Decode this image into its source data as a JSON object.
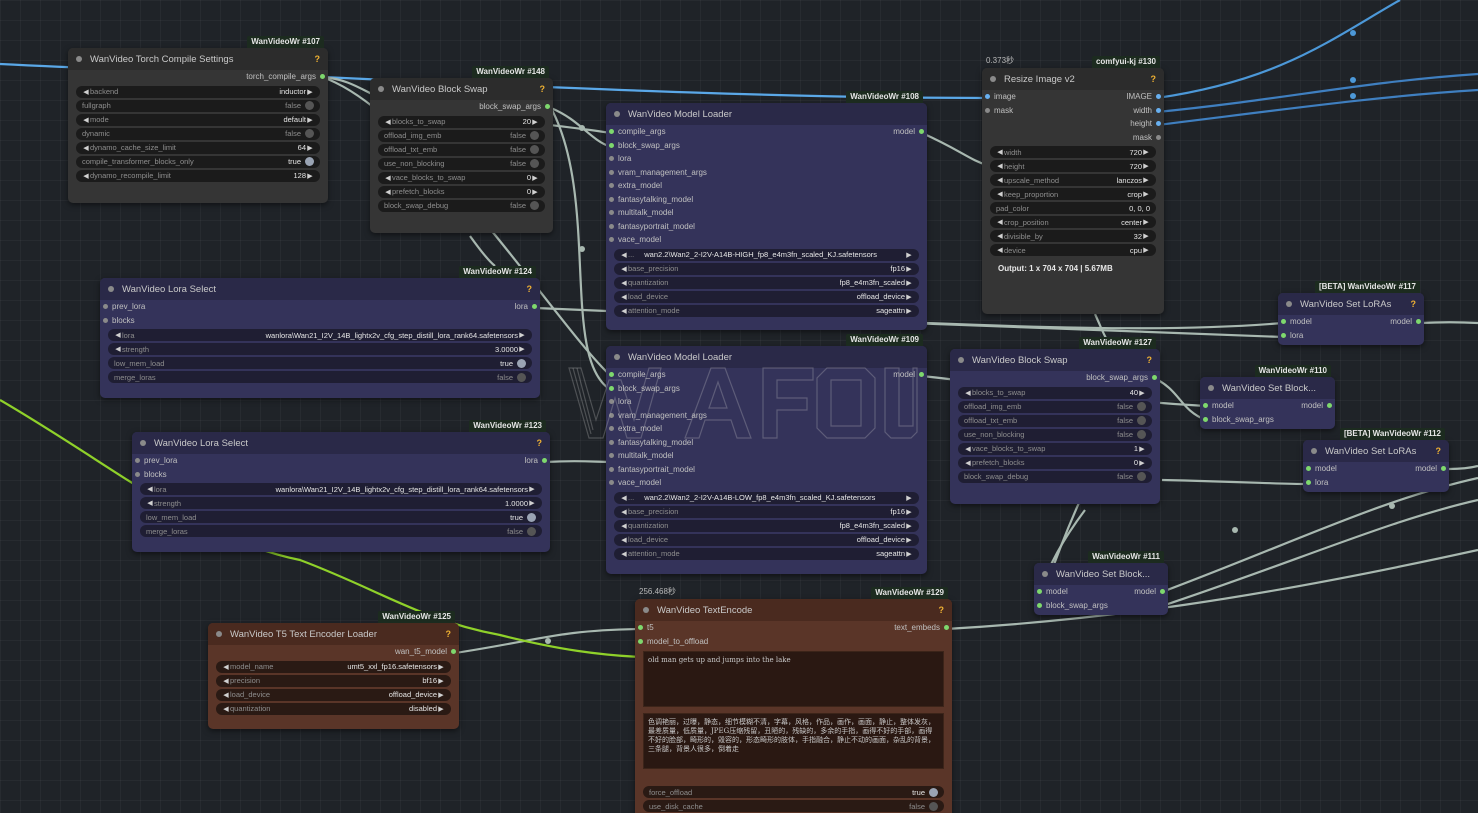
{
  "nodes": {
    "n107": {
      "badge": "WanVideoWr #107",
      "title": "WanVideo Torch Compile Settings",
      "help": "?",
      "output": "torch_compile_args",
      "widgets": {
        "backend": {
          "label": "backend",
          "value": "inductor"
        },
        "fullgraph": {
          "label": "fullgraph",
          "value": "false"
        },
        "mode": {
          "label": "mode",
          "value": "default"
        },
        "dynamic": {
          "label": "dynamic",
          "value": "false"
        },
        "dynamo_cache_size_limit": {
          "label": "dynamo_cache_size_limit",
          "value": "64"
        },
        "compile_transformer_blocks_only": {
          "label": "compile_transformer_blocks_only",
          "value": "true"
        },
        "dynamo_recompile_limit": {
          "label": "dynamo_recompile_limit",
          "value": "128"
        }
      }
    },
    "n148": {
      "badge": "WanVideoWr #148",
      "title": "WanVideo Block Swap",
      "help": "?",
      "output": "block_swap_args",
      "widgets": {
        "blocks_to_swap": {
          "label": "blocks_to_swap",
          "value": "20"
        },
        "offload_img_emb": {
          "label": "offload_img_emb",
          "value": "false"
        },
        "offload_txt_emb": {
          "label": "offload_txt_emb",
          "value": "false"
        },
        "use_non_blocking": {
          "label": "use_non_blocking",
          "value": "false"
        },
        "vace_blocks_to_swap": {
          "label": "vace_blocks_to_swap",
          "value": "0"
        },
        "prefetch_blocks": {
          "label": "prefetch_blocks",
          "value": "0"
        },
        "block_swap_debug": {
          "label": "block_swap_debug",
          "value": "false"
        }
      }
    },
    "n108": {
      "badge": "WanVideoWr #108",
      "title": "WanVideo Model Loader",
      "output": "model",
      "inputs": [
        "compile_args",
        "block_swap_args",
        "lora",
        "vram_management_args",
        "extra_model",
        "fantasytalking_model",
        "multitalk_model",
        "fantasyportrait_model",
        "vace_model"
      ],
      "widgets": {
        "model": {
          "label": "...",
          "value": "wan2.2\\Wan2_2-I2V-A14B-HIGH_fp8_e4m3fn_scaled_KJ.safetensors"
        },
        "base_precision": {
          "label": "base_precision",
          "value": "fp16"
        },
        "quantization": {
          "label": "quantization",
          "value": "fp8_e4m3fn_scaled"
        },
        "load_device": {
          "label": "load_device",
          "value": "offload_device"
        },
        "attention_mode": {
          "label": "attention_mode",
          "value": "sageattn"
        }
      }
    },
    "n109": {
      "badge": "WanVideoWr #109",
      "title": "WanVideo Model Loader",
      "output": "model",
      "inputs": [
        "compile_args",
        "block_swap_args",
        "lora",
        "vram_management_args",
        "extra_model",
        "fantasytalking_model",
        "multitalk_model",
        "fantasyportrait_model",
        "vace_model"
      ],
      "widgets": {
        "model": {
          "label": "...",
          "value": "wan2.2\\Wan2_2-I2V-A14B-LOW_fp8_e4m3fn_scaled_KJ.safetensors"
        },
        "base_precision": {
          "label": "base_precision",
          "value": "fp16"
        },
        "quantization": {
          "label": "quantization",
          "value": "fp8_e4m3fn_scaled"
        },
        "load_device": {
          "label": "load_device",
          "value": "offload_device"
        },
        "attention_mode": {
          "label": "attention_mode",
          "value": "sageattn"
        }
      }
    },
    "n130": {
      "badge": "comfyui-kj #130",
      "timing": "0.373秒",
      "title": "Resize Image v2",
      "help": "?",
      "inputs": [
        "image",
        "mask"
      ],
      "outputs": [
        "IMAGE",
        "width",
        "height",
        "mask"
      ],
      "widgets": {
        "width": {
          "label": "width",
          "value": "720"
        },
        "height": {
          "label": "height",
          "value": "720"
        },
        "upscale_method": {
          "label": "upscale_method",
          "value": "lanczos"
        },
        "keep_proportion": {
          "label": "keep_proportion",
          "value": "crop"
        },
        "pad_color": {
          "label": "pad_color",
          "value": "0, 0, 0"
        },
        "crop_position": {
          "label": "crop_position",
          "value": "center"
        },
        "divisible_by": {
          "label": "divisible_by",
          "value": "32"
        },
        "device": {
          "label": "device",
          "value": "cpu"
        }
      },
      "output_text": "Output: 1 x 704 x 704 | 5.67MB"
    },
    "n124": {
      "badge": "WanVideoWr #124",
      "title": "WanVideo Lora Select",
      "help": "?",
      "inputs": [
        "prev_lora",
        "blocks"
      ],
      "output": "lora",
      "widgets": {
        "lora": {
          "label": "lora",
          "value": "wanlora\\Wan21_I2V_14B_lightx2v_cfg_step_distill_lora_rank64.safetensors"
        },
        "strength": {
          "label": "strength",
          "value": "3.0000"
        },
        "low_mem_load": {
          "label": "low_mem_load",
          "value": "true"
        },
        "merge_loras": {
          "label": "merge_loras",
          "value": "false"
        }
      }
    },
    "n123": {
      "badge": "WanVideoWr #123",
      "title": "WanVideo Lora Select",
      "help": "?",
      "inputs": [
        "prev_lora",
        "blocks"
      ],
      "output": "lora",
      "widgets": {
        "lora": {
          "label": "lora",
          "value": "wanlora\\Wan21_I2V_14B_lightx2v_cfg_step_distill_lora_rank64.safetensors"
        },
        "strength": {
          "label": "strength",
          "value": "1.0000"
        },
        "low_mem_load": {
          "label": "low_mem_load",
          "value": "true"
        },
        "merge_loras": {
          "label": "merge_loras",
          "value": "false"
        }
      }
    },
    "n117": {
      "badge": "[BETA] WanVideoWr #117",
      "title": "WanVideo Set LoRAs",
      "help": "?",
      "inputs": [
        "model",
        "lora"
      ],
      "output": "model"
    },
    "n127": {
      "badge": "WanVideoWr #127",
      "title": "WanVideo Block Swap",
      "help": "?",
      "output": "block_swap_args",
      "widgets": {
        "blocks_to_swap": {
          "label": "blocks_to_swap",
          "value": "40"
        },
        "offload_img_emb": {
          "label": "offload_img_emb",
          "value": "false"
        },
        "offload_txt_emb": {
          "label": "offload_txt_emb",
          "value": "false"
        },
        "use_non_blocking": {
          "label": "use_non_blocking",
          "value": "false"
        },
        "vace_blocks_to_swap": {
          "label": "vace_blocks_to_swap",
          "value": "1"
        },
        "prefetch_blocks": {
          "label": "prefetch_blocks",
          "value": "0"
        },
        "block_swap_debug": {
          "label": "block_swap_debug",
          "value": "false"
        }
      }
    },
    "n110": {
      "badge": "WanVideoWr #110",
      "title": "WanVideo Set Block...",
      "inputs": [
        "model",
        "block_swap_args"
      ],
      "output": "model"
    },
    "n112": {
      "badge": "[BETA] WanVideoWr #112",
      "title": "WanVideo Set LoRAs",
      "help": "?",
      "inputs": [
        "model",
        "lora"
      ],
      "output": "model"
    },
    "n111": {
      "badge": "WanVideoWr #111",
      "title": "WanVideo Set Block...",
      "inputs": [
        "model",
        "block_swap_args"
      ],
      "output": "model"
    },
    "n125": {
      "badge": "WanVideoWr #125",
      "title": "WanVideo T5 Text Encoder Loader",
      "help": "?",
      "output": "wan_t5_model",
      "widgets": {
        "model_name": {
          "label": "model_name",
          "value": "umt5_xxl_fp16.safetensors"
        },
        "precision": {
          "label": "precision",
          "value": "bf16"
        },
        "load_device": {
          "label": "load_device",
          "value": "offload_device"
        },
        "quantization": {
          "label": "quantization",
          "value": "disabled"
        }
      }
    },
    "n129": {
      "badge": "WanVideoWr #129",
      "timing": "256.468秒",
      "title": "WanVideo TextEncode",
      "help": "?",
      "inputs": [
        "t5",
        "model_to_offload"
      ],
      "output": "text_embeds",
      "positive_prompt": "old man gets up and jumps into the lake",
      "negative_prompt": "色调艳丽，过曝，静态，细节模糊不清，字幕，风格，作品，画作，画面，静止，整体发灰，最差质量，低质量，JPEG压缩残留，丑陋的，残缺的，多余的手指，画得不好的手部，画得不好的脸部，畸形的，毁容的，形态畸形的肢体，手指融合，静止不动的画面，杂乱的背景，三条腿，背景人很多，倒着走",
      "widgets": {
        "force_offload": {
          "label": "force_offload",
          "value": "true"
        },
        "use_disk_cache": {
          "label": "use_disk_cache",
          "value": "false"
        }
      }
    }
  },
  "colors": {
    "canvas": "#1f2328",
    "wire_default": "#a8b8b0",
    "wire_image": "#68b0f0",
    "wire_t5": "#8fd12a",
    "node_purple": "#34335a",
    "node_brown": "#5a3528",
    "node_gray": "#353535"
  }
}
